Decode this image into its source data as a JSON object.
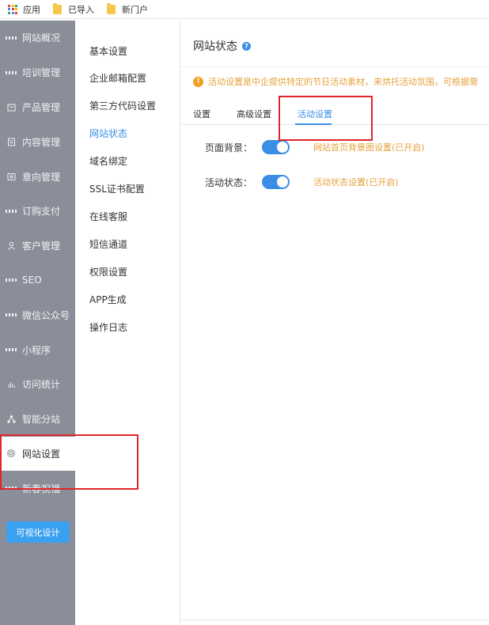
{
  "bookmarks": [
    {
      "label": "应用",
      "icon": "apps-grid-icon"
    },
    {
      "label": "已导入",
      "icon": "folder-icon"
    },
    {
      "label": "新门户",
      "icon": "folder-icon"
    }
  ],
  "sidebar": {
    "items": [
      {
        "label": "网站概况",
        "icon": "grid-icon"
      },
      {
        "label": "培训管理",
        "icon": "grid-icon"
      },
      {
        "label": "产品管理",
        "icon": "bag-icon"
      },
      {
        "label": "内容管理",
        "icon": "document-icon"
      },
      {
        "label": "意向管理",
        "icon": "intent-icon"
      },
      {
        "label": "订购支付",
        "icon": "grid-icon"
      },
      {
        "label": "客户管理",
        "icon": "user-icon"
      },
      {
        "label": "SEO",
        "icon": "grid-icon"
      },
      {
        "label": "微信公众号",
        "icon": "grid-icon"
      },
      {
        "label": "小程序",
        "icon": "grid-icon"
      },
      {
        "label": "访问统计",
        "icon": "bar-chart-icon"
      },
      {
        "label": "智能分站",
        "icon": "network-icon"
      },
      {
        "label": "网站设置",
        "icon": "gear-icon",
        "active": true
      },
      {
        "label": "新春祝福",
        "icon": "grid-icon"
      }
    ],
    "visual_design_button": "可视化设计"
  },
  "subnav": {
    "items": [
      {
        "label": "基本设置"
      },
      {
        "label": "企业邮箱配置"
      },
      {
        "label": "第三方代码设置"
      },
      {
        "label": "网站状态",
        "active": true
      },
      {
        "label": "域名绑定"
      },
      {
        "label": "SSL证书配置"
      },
      {
        "label": "在线客服"
      },
      {
        "label": "短信通道"
      },
      {
        "label": "权限设置"
      },
      {
        "label": "APP生成"
      },
      {
        "label": "操作日志"
      }
    ]
  },
  "main": {
    "title": "网站状态",
    "notice": "活动设置是中企提供特定的节日活动素材，来烘托活动氛围，可根据需",
    "tabs": [
      {
        "label": "设置"
      },
      {
        "label": "高级设置"
      },
      {
        "label": "活动设置",
        "active": true
      }
    ],
    "settings": [
      {
        "label": "页面背景：",
        "enabled": true,
        "link": "网站首页背景图设置(已开启)"
      },
      {
        "label": "活动状态：",
        "enabled": true,
        "link": "活动状态设置(已开启)"
      }
    ]
  },
  "colors": {
    "accent": "#3a8ee6",
    "sidebar_bg": "#8a8e99",
    "warning": "#e6a23c",
    "highlight": "#e0262b",
    "button": "#3aa0f0"
  }
}
